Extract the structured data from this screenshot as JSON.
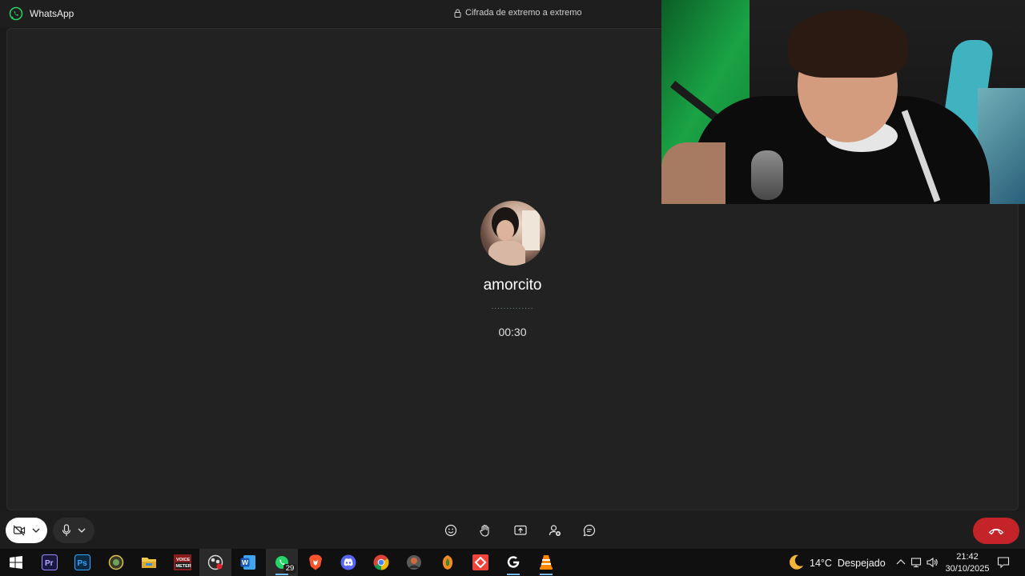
{
  "window": {
    "app_title": "WhatsApp",
    "encryption_text": "Cifrada de extremo a extremo"
  },
  "call": {
    "contact_name": "amorcito",
    "status_dots": "..............",
    "timer": "00:30"
  },
  "controls": {
    "camera": "camera-off-icon",
    "microphone": "microphone-icon",
    "center_actions": [
      "emoji-reaction-icon",
      "raise-hand-icon",
      "share-screen-icon",
      "add-participant-icon",
      "chat-icon"
    ],
    "end_call": "end-call-icon",
    "end_call_color": "#c4232a"
  },
  "taskbar": {
    "whatsapp_badge": "29",
    "weather_temp": "14°C",
    "weather_desc": "Despejado",
    "time": "21:42",
    "date": "30/10/2025"
  }
}
